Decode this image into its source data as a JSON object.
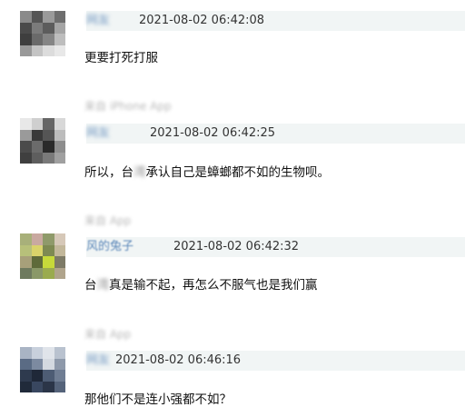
{
  "comments": [
    {
      "username": "网友",
      "timestamp": "2021-08-02 06:42:08",
      "text": "更要打死打服",
      "source": ""
    },
    {
      "username": "网友",
      "timestamp": "2021-08-02 06:42:25",
      "text_before": "所以，台",
      "text_hidden": "湾",
      "text_after": "承认自己是蟑螂都不如的生物呗。",
      "source": "来自 iPhone App"
    },
    {
      "username": "风的兔子",
      "timestamp": "2021-08-02 06:42:32",
      "text_before": "台",
      "text_hidden": "湾",
      "text_after": "真是输不起，再怎么不服气也是我们赢",
      "source": "来自 App"
    },
    {
      "username": "网友",
      "timestamp": "2021-08-02 06:46:16",
      "text": "那他们不是连小强都不如？",
      "source": "来自 App"
    }
  ],
  "colors": {
    "header_bg": "#f1f5f5",
    "username": "#5a86b8",
    "text": "#111111"
  }
}
